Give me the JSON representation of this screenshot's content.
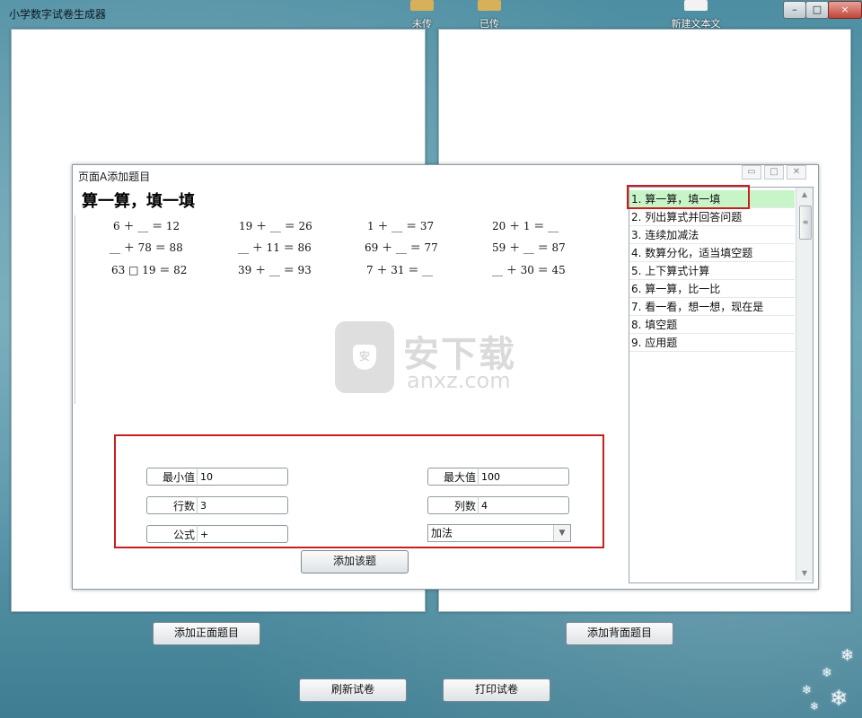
{
  "window": {
    "title": "小学数字试卷生成器",
    "buttons": [
      "–",
      "□",
      "×"
    ]
  },
  "desktop_icons": [
    {
      "label": "未传"
    },
    {
      "label": "已传"
    },
    {
      "label": "新建文本文"
    }
  ],
  "dialog": {
    "title": "页面A添加题目",
    "section_title": "算一算，填一填",
    "problems": [
      [
        "6 ＋ __ ＝ 12",
        "19 ＋ __ ＝ 26",
        "1 ＋ __ ＝ 37",
        "20 ＋ 1 ＝ __"
      ],
      [
        "__ ＋ 78 ＝ 88",
        "__ ＋ 11 ＝ 86",
        "69 ＋ __ ＝ 77",
        "59 ＋ __ ＝ 87"
      ],
      [
        "63 □ 19 ＝ 82",
        "39 ＋ __ ＝ 93",
        "7 ＋ 31 ＝ __",
        "__ ＋ 30 ＝ 45"
      ]
    ],
    "fields": {
      "min_label": "最小值",
      "min_value": "10",
      "max_label": "最大值",
      "max_value": "100",
      "rows_label": "行数",
      "rows_value": "3",
      "cols_label": "列数",
      "cols_value": "4",
      "formula_label": "公式",
      "formula_value": "+",
      "operation_value": "加法"
    },
    "add_button": "添加该题",
    "question_types": [
      "1. 算一算，填一填",
      "2. 列出算式并回答问题",
      "3. 连续加减法",
      "4. 数算分化，适当填空题",
      "5. 上下算式计算",
      "6. 算一算，比一比",
      "7. 看一看，想一想，现在是",
      "8. 填空题",
      "9. 应用题"
    ],
    "selected_index": 0
  },
  "buttons": {
    "add_front": "添加正面题目",
    "add_back": "添加背面题目",
    "refresh": "刷新试卷",
    "print": "打印试卷"
  },
  "watermark": {
    "text": "安下载",
    "sub": "anxz.com"
  }
}
